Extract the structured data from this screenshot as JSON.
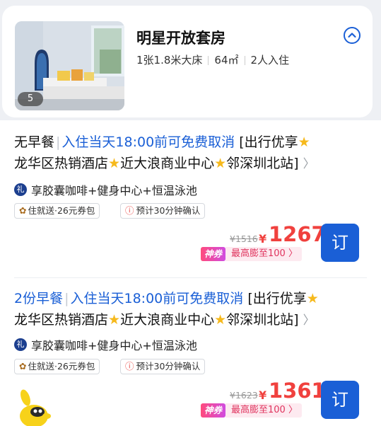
{
  "room": {
    "title": "明星开放套房",
    "bed": "1张1.8米大床",
    "area": "64㎡",
    "guests": "2人入住",
    "photo_count": "5",
    "collapse_icon": "chevron-up-circle-icon"
  },
  "offers": [
    {
      "meal": "无早餐",
      "cancel": "入住当天18:00前可免费取消",
      "title_rest_1": "[出行优享",
      "title_rest_2": "龙华区热销酒店",
      "title_rest_3": "近大浪商业中心",
      "title_rest_4": "邻深圳北站]",
      "perk_badge": "礼",
      "perks": "享胶囊咖啡+健身中心+恒温泳池",
      "tag_delivery": "住就送·26元券包",
      "tag_confirm": "预计30分钟确认",
      "old_price": "¥1516",
      "currency": "¥",
      "price": "1267",
      "book": "订",
      "promo_badge": "神券",
      "promo_text": "最高膨至100 〉"
    },
    {
      "meal": "2份早餐",
      "cancel": "入住当天18:00前可免费取消",
      "title_rest_1": "[出行优享",
      "title_rest_2": "龙华区热销酒店",
      "title_rest_3": "近大浪商业中心",
      "title_rest_4": "邻深圳北站]",
      "perk_badge": "礼",
      "perks": "享胶囊咖啡+健身中心+恒温泳池",
      "tag_delivery": "住就送·26元券包",
      "tag_confirm": "预计30分钟确认",
      "old_price": "¥1623",
      "currency": "¥",
      "price": "1361",
      "book": "订",
      "promo_badge": "神券",
      "promo_text": "最高膨至100 〉"
    }
  ],
  "colors": {
    "accent": "#1a5fd6",
    "price": "#f0413e",
    "star": "#f6b91c",
    "promo_pink": "#e0345e"
  }
}
